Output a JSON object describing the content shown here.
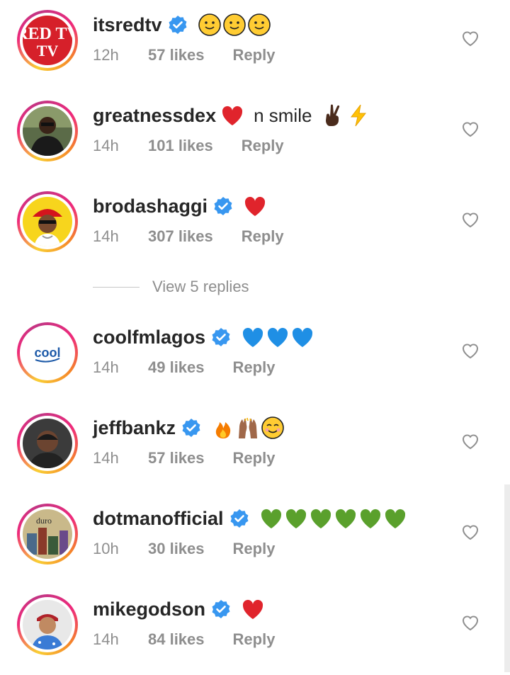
{
  "comments": [
    {
      "username": "itsredtv",
      "verified": true,
      "text": "",
      "emojis": [
        "slightly-smiling-face",
        "slightly-smiling-face",
        "slightly-smiling-face"
      ],
      "time": "12h",
      "likes": "57 likes",
      "reply": "Reply",
      "avatar_text": "RED TV"
    },
    {
      "username": "greatnessdex",
      "verified": false,
      "text": "n smile",
      "emojis_before": [
        "red-heart"
      ],
      "emojis": [
        "crossed-fingers",
        "high-voltage"
      ],
      "time": "14h",
      "likes": "101 likes",
      "reply": "Reply"
    },
    {
      "username": "brodashaggi",
      "verified": true,
      "text": "",
      "emojis": [
        "red-heart"
      ],
      "time": "14h",
      "likes": "307 likes",
      "reply": "Reply"
    },
    {
      "username": "coolfmlagos",
      "verified": true,
      "text": "",
      "emojis": [
        "blue-heart",
        "blue-heart",
        "blue-heart"
      ],
      "time": "14h",
      "likes": "49 likes",
      "reply": "Reply",
      "avatar_text": "cool"
    },
    {
      "username": "jeffbankz",
      "verified": true,
      "text": "",
      "emojis": [
        "fire",
        "raising-hands",
        "smiling-face-with-smiling-eyes"
      ],
      "time": "14h",
      "likes": "57 likes",
      "reply": "Reply"
    },
    {
      "username": "dotmanofficial",
      "verified": true,
      "text": "",
      "emojis": [
        "green-heart",
        "green-heart",
        "green-heart",
        "green-heart",
        "green-heart",
        "green-heart"
      ],
      "time": "10h",
      "likes": "30 likes",
      "reply": "Reply",
      "avatar_text": "duro"
    },
    {
      "username": "mikegodson",
      "verified": true,
      "text": "",
      "emojis": [
        "red-heart"
      ],
      "time": "14h",
      "likes": "84 likes",
      "reply": "Reply"
    }
  ],
  "view_replies": "View 5 replies",
  "colors": {
    "verified": "#3897f0",
    "meta": "#8e8e8e",
    "username": "#262626"
  }
}
